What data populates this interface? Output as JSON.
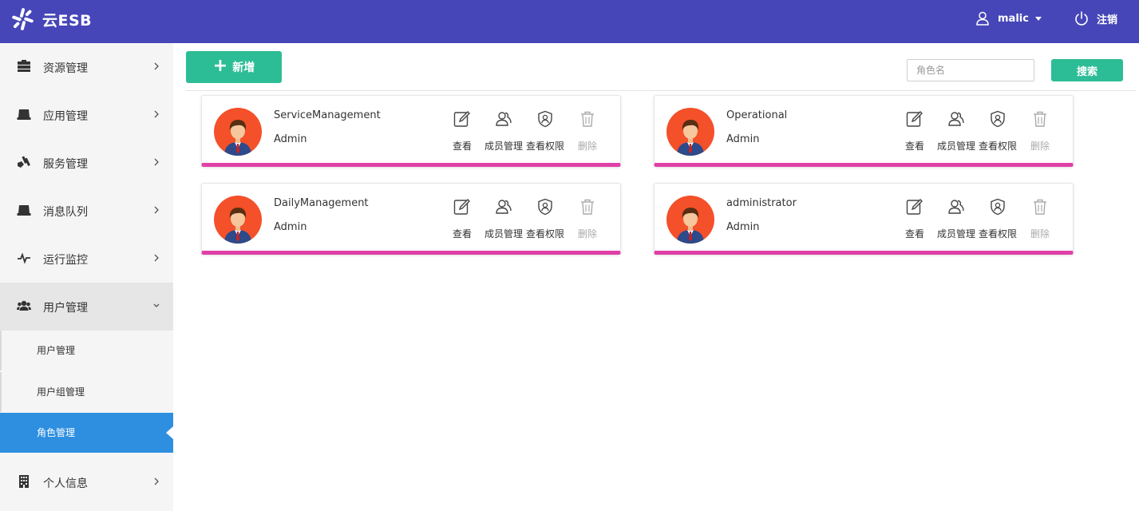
{
  "header": {
    "app_title": "云ESB",
    "user_name": "malic",
    "logout_label": "注销",
    "bg_color": "#4646b8"
  },
  "sidebar": {
    "items": [
      {
        "label": "资源管理",
        "icon": "server-stack-icon"
      },
      {
        "label": "应用管理",
        "icon": "laptop-icon"
      },
      {
        "label": "服务管理",
        "icon": "service-icon"
      },
      {
        "label": "消息队列",
        "icon": "laptop-icon"
      },
      {
        "label": "运行监控",
        "icon": "pulse-icon"
      },
      {
        "label": "用户管理",
        "icon": "users-icon"
      },
      {
        "label": "个人信息",
        "icon": "building-icon"
      }
    ],
    "sub_items": [
      {
        "label": "用户管理"
      },
      {
        "label": "用户组管理"
      },
      {
        "label": "角色管理"
      }
    ],
    "active_color": "#2e8fe0"
  },
  "toolbar": {
    "add_label": "新增",
    "search_placeholder": "角色名",
    "search_label": "搜索",
    "accent_color": "#2dbd96"
  },
  "cards": [
    {
      "name": "ServiceManagement",
      "sub": "Admin"
    },
    {
      "name": "Operational",
      "sub": "Admin"
    },
    {
      "name": "DailyManagement",
      "sub": "Admin"
    },
    {
      "name": "administrator",
      "sub": "Admin"
    }
  ],
  "card_actions": {
    "view": "查看",
    "members": "成员管理",
    "permissions": "查看权限",
    "delete": "删除"
  },
  "card_bar_color": "#e040a8"
}
